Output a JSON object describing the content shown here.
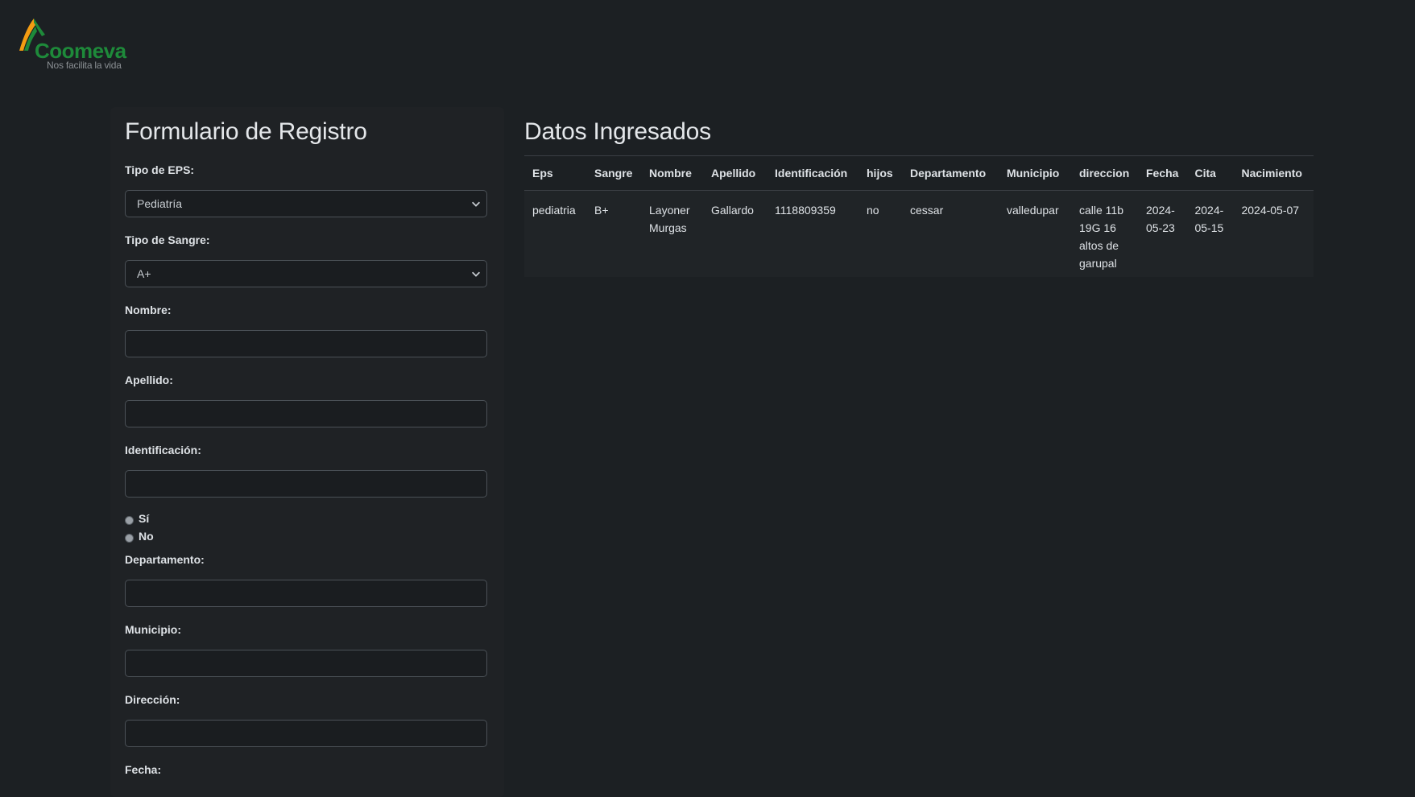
{
  "brand": {
    "name": "Coomeva",
    "tagline": "Nos facilita la vida",
    "colors": {
      "green": "#1e8a3a",
      "orange": "#f39c12"
    }
  },
  "form": {
    "title": "Formulario de Registro",
    "eps": {
      "label": "Tipo de EPS:",
      "value": "Pediatría"
    },
    "blood": {
      "label": "Tipo de Sangre:",
      "value": "A+"
    },
    "nombre": {
      "label": "Nombre:",
      "value": ""
    },
    "apellido": {
      "label": "Apellido:",
      "value": ""
    },
    "identificacion": {
      "label": "Identificación:",
      "value": ""
    },
    "children": {
      "yes_label": "Sí",
      "no_label": "No"
    },
    "departamento": {
      "label": "Departamento:",
      "value": ""
    },
    "municipio": {
      "label": "Municipio:",
      "value": ""
    },
    "direccion": {
      "label": "Dirección:",
      "value": ""
    },
    "fecha": {
      "label": "Fecha:"
    }
  },
  "data": {
    "title": "Datos Ingresados",
    "columns": [
      "Eps",
      "Sangre",
      "Nombre",
      "Apellido",
      "Identificación",
      "hijos",
      "Departamento",
      "Municipio",
      "direccion",
      "Fecha",
      "Cita",
      "Nacimiento"
    ],
    "rows": [
      {
        "eps": "pediatria",
        "sangre": "B+",
        "nombre": "Layoner Murgas",
        "apellido": "Gallardo",
        "identificacion": "1118809359",
        "hijos": "no",
        "departamento": "cessar",
        "municipio": "valledupar",
        "direccion": "calle 11b 19G 16 altos de garupal",
        "fecha": "2024-05-23",
        "cita": "2024-05-15",
        "nacimiento": "2024-05-07"
      }
    ]
  }
}
